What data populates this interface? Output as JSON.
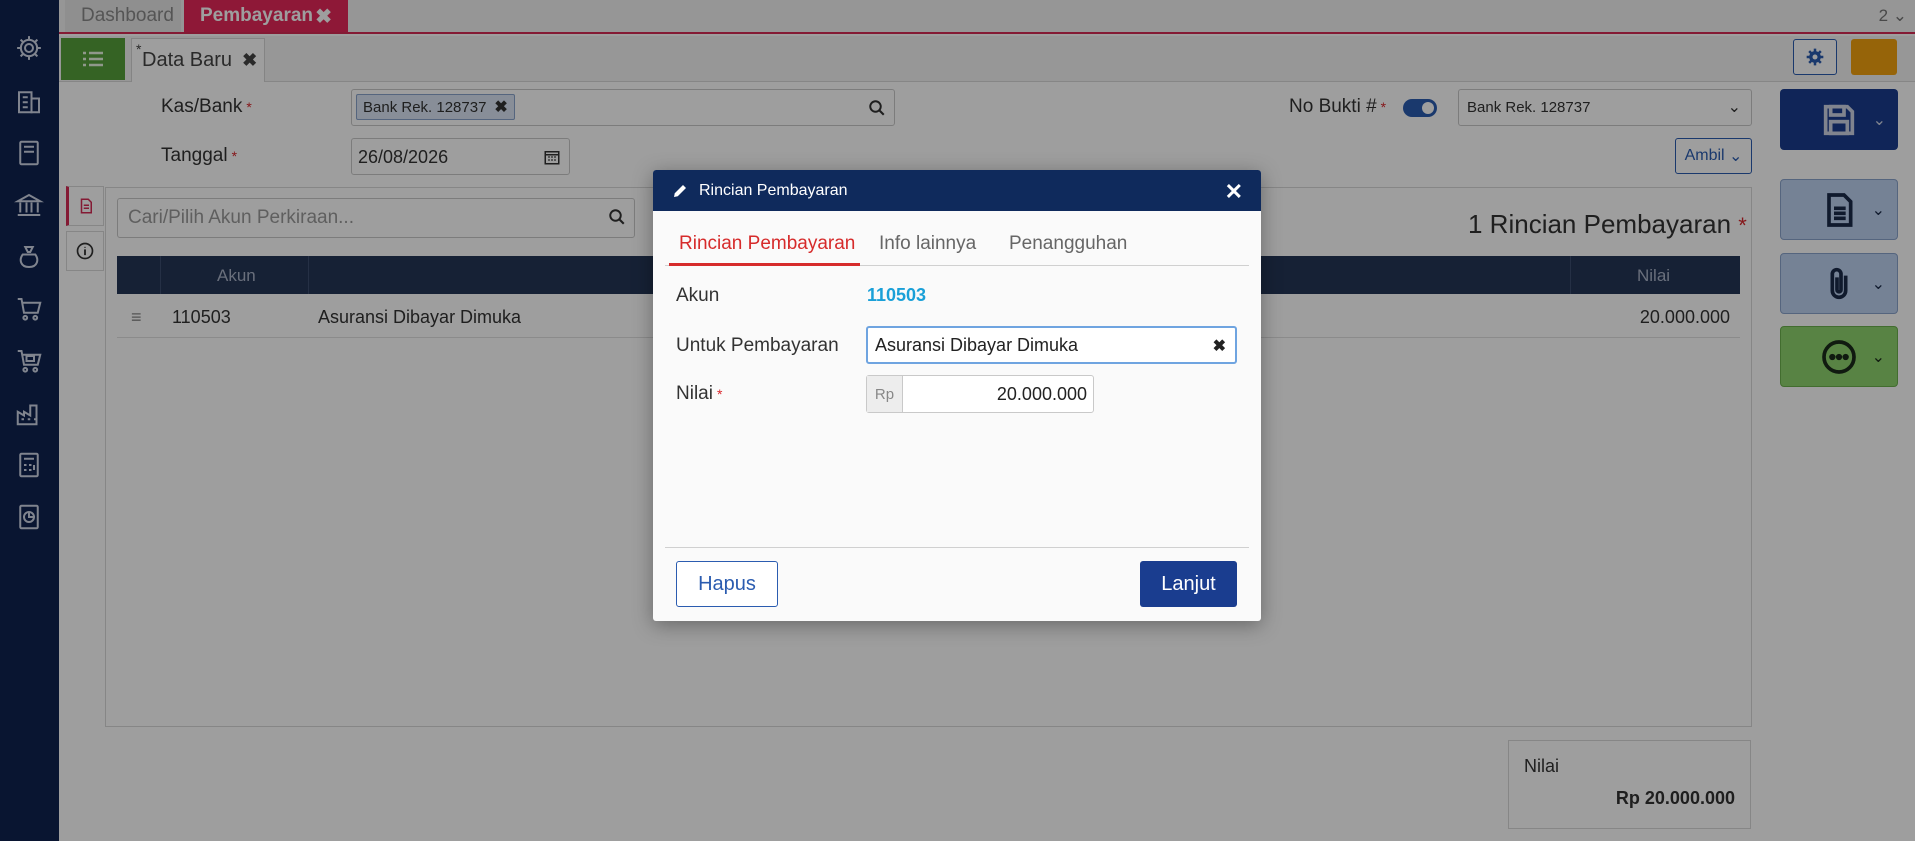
{
  "top_tabs": {
    "dashboard": "Dashboard",
    "pembayaran": "Pembayaran",
    "close": "✖",
    "page_indicator": "2"
  },
  "sub_tab": {
    "label": "Data Baru",
    "modified_marker": "*",
    "close": "✖"
  },
  "form": {
    "kas_bank_label": "Kas/Bank",
    "kas_bank_value": "Bank Rek. 128737",
    "tanggal_label": "Tanggal",
    "tanggal_value": "26/08/2026",
    "no_bukti_label": "No Bukti #",
    "no_bukti_select": "Bank Rek. 128737",
    "ambil_label": "Ambil",
    "required_marker": "*"
  },
  "detail": {
    "search_placeholder": "Cari/Pilih Akun Perkiraan...",
    "count_label": "1 Rincian Pembayaran",
    "columns": {
      "akun": "Akun",
      "nilai": "Nilai"
    },
    "rows": [
      {
        "akun": "110503",
        "nama": "Asuransi Dibayar Dimuka",
        "nilai": "20.000.000"
      }
    ]
  },
  "summary": {
    "label": "Nilai",
    "value": "Rp 20.000.000"
  },
  "modal": {
    "title": "Rincian Pembayaran",
    "close": "✕",
    "tabs": [
      "Rincian Pembayaran",
      "Info lainnya",
      "Penangguhan"
    ],
    "akun_label": "Akun",
    "akun_value": "110503",
    "untuk_label": "Untuk Pembayaran",
    "untuk_value": "Asuransi Dibayar Dimuka",
    "nilai_label": "Nilai",
    "currency": "Rp",
    "nilai_value": "20.000.000",
    "hapus": "Hapus",
    "lanjut": "Lanjut"
  },
  "colors": {
    "sidebar": "#0f2350",
    "accent_red": "#e5285a",
    "primary": "#1a3d8f",
    "success": "#56a03a",
    "warning": "#f2a20f"
  }
}
